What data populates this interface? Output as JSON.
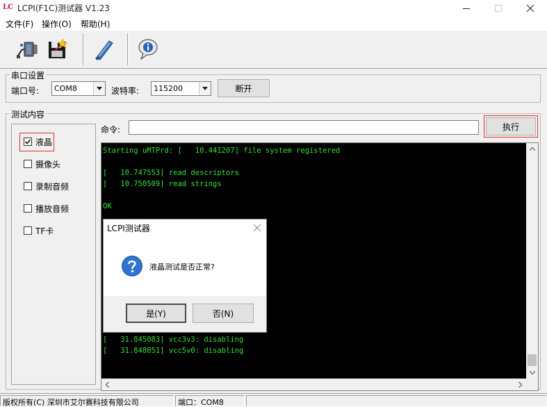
{
  "window": {
    "logo": "LC",
    "title": "LCPI(F1C)测试器 V1.23"
  },
  "menu": [
    "文件(F)",
    "操作(O)",
    "帮助(H)"
  ],
  "toolbar": {
    "icons": [
      "connect-port-icon",
      "save-disk-icon",
      "flash-wand-icon",
      "info-icon"
    ]
  },
  "serial": {
    "group_label": "串口设置",
    "port_label": "端口号:",
    "port_value": "COM8",
    "baud_label": "波特率:",
    "baud_value": "115200",
    "disconnect_label": "断开"
  },
  "tests": {
    "group_label": "测试内容",
    "items": [
      {
        "label": "液晶",
        "checked": true
      },
      {
        "label": "摄像头",
        "checked": false
      },
      {
        "label": "录制音频",
        "checked": false
      },
      {
        "label": "播放音频",
        "checked": false
      },
      {
        "label": "TF卡",
        "checked": false
      }
    ]
  },
  "command": {
    "label": "命令:",
    "value": "",
    "run_label": "执行"
  },
  "console": {
    "lines": [
      "Starting uMTPrd: [   10.441207] file system registered",
      "",
      "[   10.747553] read descriptors",
      "[   10.750509] read strings",
      "",
      "OK",
      "",
      "",
      "",
      "",
      "",
      "",
      "",
      "",
      "",
      "",
      "",
      "[   31.845083] vcc3v3: disabling",
      "[   31.848051] vcc5v0: disabling"
    ]
  },
  "dialog": {
    "title": "LCPI测试器",
    "message": "液晶测试是否正常?",
    "yes_label": "是(Y)",
    "no_label": "否(N)"
  },
  "status": {
    "company": "版权所有(C) 深圳市艾尔赛科技有限公司",
    "port": "端口：COM8"
  },
  "colors": {
    "console_bg": "#000000",
    "console_text": "#35e035",
    "highlight": "#e03030"
  }
}
